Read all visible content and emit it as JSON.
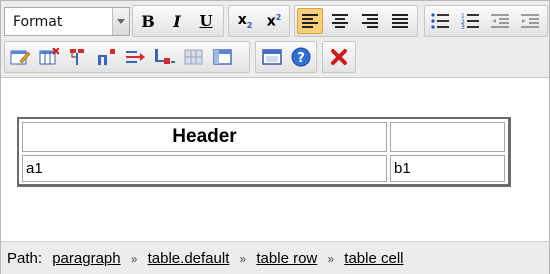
{
  "toolbar": {
    "format_label": "Format",
    "bold": "B",
    "italic": "I",
    "underline": "U",
    "subscript": "x",
    "subscript_mark": "2",
    "superscript": "x",
    "superscript_mark": "2"
  },
  "editor": {
    "table": {
      "header": [
        "Header",
        ""
      ],
      "rows": [
        [
          "a1",
          "b1"
        ]
      ]
    }
  },
  "status": {
    "path_label": "Path:",
    "crumbs": [
      "paragraph",
      "table.default",
      "table row",
      "table cell"
    ],
    "separator": "»"
  },
  "colors": {
    "toolbar_bg": "#ececec",
    "active_bg": "#f9cf7c",
    "accent_blue": "#2a56c6",
    "delete_red": "#cc1b1b"
  }
}
